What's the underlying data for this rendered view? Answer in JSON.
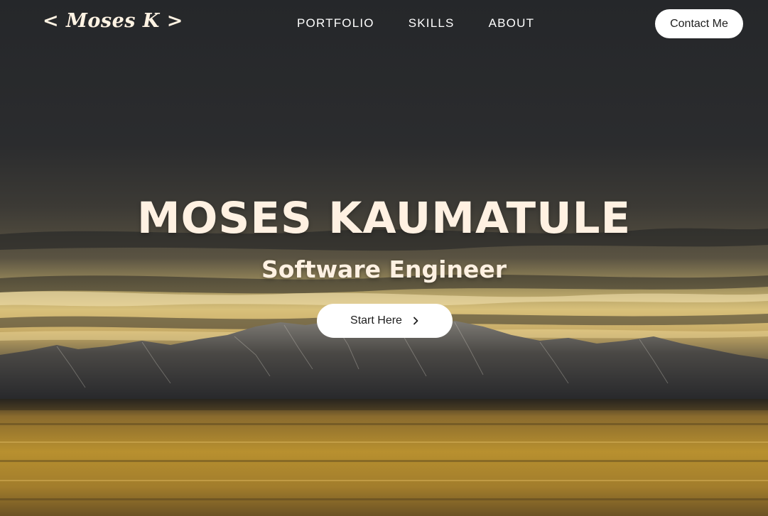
{
  "nav": {
    "logo": "< Moses K >",
    "menu": [
      {
        "label": "PORTFOLIO"
      },
      {
        "label": "SKILLS"
      },
      {
        "label": "ABOUT"
      }
    ],
    "contact_label": "Contact Me"
  },
  "hero": {
    "title": "MOSES KAUMATULE",
    "subtitle": "Software Engineer",
    "cta_label": "Start Here",
    "cta_icon": "chevron-right-icon"
  },
  "colors": {
    "sky_dark": "#2b2c2e",
    "sunset_gold": "#d9b35c",
    "title_cream": "#fff1e2",
    "button_white": "#ffffff"
  }
}
